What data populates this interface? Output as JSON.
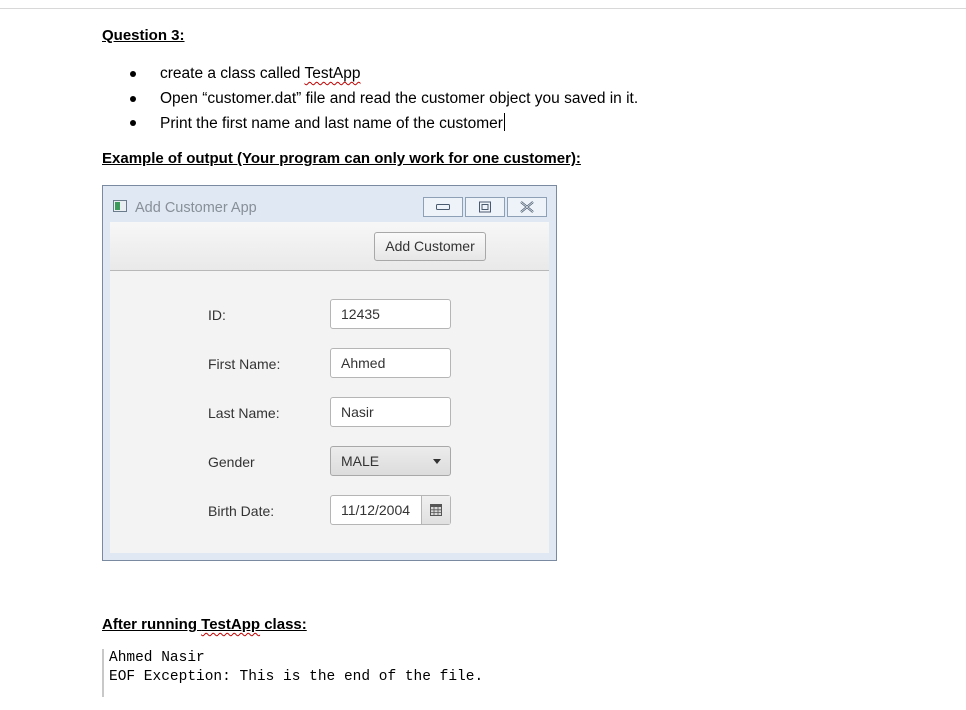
{
  "question": {
    "title": "Question 3:",
    "bullets": [
      {
        "prefix": "create a class called ",
        "highlight": "TestApp"
      },
      {
        "text": "Open “customer.dat” file and read the customer object you saved in it."
      },
      {
        "text": "Print the first name and last name of the customer"
      }
    ]
  },
  "example_title": "Example of output (Your program can only work for one customer):",
  "app_window": {
    "title": "Add Customer App",
    "add_button": "Add Customer",
    "form": {
      "id_label": "ID:",
      "id_value": "12435",
      "first_name_label": "First Name:",
      "first_name_value": "Ahmed",
      "last_name_label": "Last Name:",
      "last_name_value": "Nasir",
      "gender_label": "Gender",
      "gender_value": "MALE",
      "birth_date_label": "Birth Date:",
      "birth_date_value": "11/12/2004"
    }
  },
  "after_running": {
    "prefix": "After running ",
    "highlight": "TestApp",
    "suffix": " class:"
  },
  "console_output": [
    "Ahmed Nasir",
    "EOF Exception: This is the end of the file."
  ],
  "colors": {
    "spell_underline": "#c00000",
    "window_frame": "#dfe8f3",
    "window_title": "#888f98"
  }
}
